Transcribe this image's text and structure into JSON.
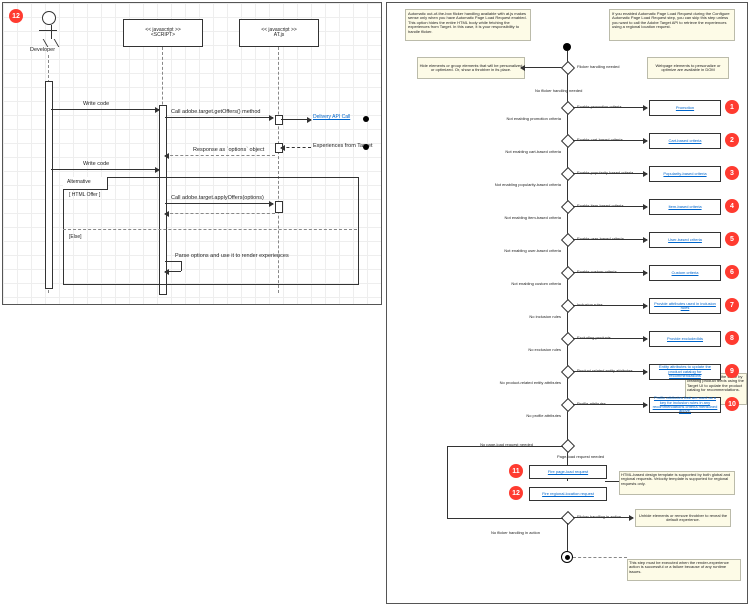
{
  "left": {
    "badge": "12",
    "actor": "Developer",
    "participant_js_script": "<< javascript >>\n<SCRIPT>",
    "participant_atjs": "<< javascript >>\nAT.js",
    "msg_write_code_1": "Write code",
    "msg_get_offers": "Call adobe.target.getOffers() method",
    "delivery_api": "Delivery API Call",
    "msg_response": "Response as `options` object",
    "experiences": "Experiences from Target",
    "msg_write_code_2": "Write code",
    "alt_label": "Alternative",
    "alt_cond": "[ HTML Offer ]",
    "msg_apply_options": "Call adobe.target.applyOffers(options)",
    "alt_else": "[Else]",
    "msg_render": "Parse options and use it to render experiences"
  },
  "right": {
    "top_note_left": "Automatic out-of-the-box flicker handling available with at.js makes sense only when you have Automatic Page Load Request enabled. This option hides the entire HTML body while fetching the experiences from Target. In this case, it is your responsibility to handle flicker.",
    "top_note_right": "If you enabled Automatic Page Load Request during the Configure Automatic Page Load Request step, you can skip this step unless you want to call the Adobe Target API to retrieve the experiences using a regional location request.",
    "hide_elements": "Hide elements or group elements that will be personalized or optimized. Or, show a throbber in its place.",
    "flicker_needed": "Flicker handling needed",
    "dom_note": "Webpage elements to personalize or optimize are available in DOM",
    "no_flicker": "No flicker handling needed",
    "steps": [
      {
        "n": "1",
        "cond": "Enable promotion criteria",
        "link": "Promotion",
        "neg": "Not enabling promotion criteria"
      },
      {
        "n": "2",
        "cond": "Enable cart-based criteria",
        "link": "Cart-based criteria",
        "neg": "Not enabling cart-based criteria"
      },
      {
        "n": "3",
        "cond": "Enable popularity-based criteria",
        "link": "Popularity-based criteria",
        "neg": "Not enabling popularity-based criteria"
      },
      {
        "n": "4",
        "cond": "Enable item-based criteria",
        "link": "Item-based criteria",
        "neg": "Not enabling item-based criteria"
      },
      {
        "n": "5",
        "cond": "Enable user-based criteria",
        "link": "User-based criteria",
        "neg": "Not enabling user-based criteria"
      },
      {
        "n": "6",
        "cond": "Enable custom criteria",
        "link": "Custom criteria",
        "neg": "Not enabling custom criteria"
      },
      {
        "n": "7",
        "cond": "Inclusion rules",
        "link": "Provide attributes used in inclusion rules",
        "neg": "No inclusion rules"
      },
      {
        "n": "8",
        "cond": "Excluding products",
        "link": "Provide excludedIds",
        "neg": "No exclusion rules"
      },
      {
        "n": "9",
        "cond": "Product-related entity attributes",
        "link": "Entity attributes to update the product catalog for recommendations",
        "neg": "No product-related entity attributes"
      },
      {
        "n": "10",
        "cond": "Profile attributes",
        "link": "Profile attributes that are used as a key for inclusion rules in any recommendations criteria mentioned above.",
        "neg": "No profile attributes"
      }
    ],
    "product_feed_note": "You can also send the same by creating product feeds using the Target UI to update the product catalog for recommendations.",
    "no_page_load": "No page-load request needed",
    "page_load_needed": "Page-load request needed",
    "fire_page_load": "Fire page-load request",
    "fire_regional": "Fire regional-location request",
    "template_note": "HTML-based design template is supported by both global and regional requests. Velocity template is supported for regional requests only.",
    "badge11": "11",
    "badge12": "12",
    "flicker_action": "Flicker handling in action",
    "unhide": "Unhide elements or remove throbber to reveal the default experience.",
    "no_flicker_action": "No flicker handling in action",
    "final_note": "This step must be executed when the render-experience action is successful or a failure because of any runtime issues."
  }
}
